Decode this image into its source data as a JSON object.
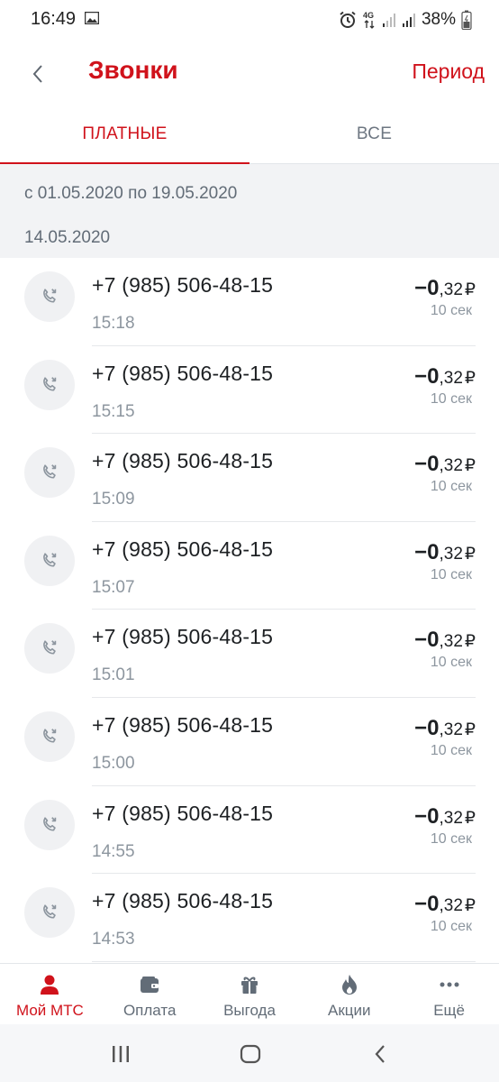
{
  "status_bar": {
    "time": "16:49",
    "battery": "38%",
    "network": "4G",
    "icons": [
      "gallery-icon",
      "alarm-icon",
      "network-4g-icon",
      "signal-icon",
      "signal-icon",
      "battery-icon"
    ]
  },
  "header": {
    "title": "Звонки",
    "period_label": "Период",
    "accent_color": "#d0121b"
  },
  "tabs": [
    {
      "label": "ПЛАТНЫЕ",
      "active": true
    },
    {
      "label": "ВСЕ",
      "active": false
    }
  ],
  "filter": {
    "range": "с 01.05.2020 по 19.05.2020",
    "date_header": "14.05.2020"
  },
  "calls": [
    {
      "number": "+7 (985) 506-48-15",
      "time": "15:18",
      "amount_int": "−0",
      "amount_frac": ",32",
      "currency": "₽",
      "duration": "10 сек"
    },
    {
      "number": "+7 (985) 506-48-15",
      "time": "15:15",
      "amount_int": "−0",
      "amount_frac": ",32",
      "currency": "₽",
      "duration": "10 сек"
    },
    {
      "number": "+7 (985) 506-48-15",
      "time": "15:09",
      "amount_int": "−0",
      "amount_frac": ",32",
      "currency": "₽",
      "duration": "10 сек"
    },
    {
      "number": "+7 (985) 506-48-15",
      "time": "15:07",
      "amount_int": "−0",
      "amount_frac": ",32",
      "currency": "₽",
      "duration": "10 сек"
    },
    {
      "number": "+7 (985) 506-48-15",
      "time": "15:01",
      "amount_int": "−0",
      "amount_frac": ",32",
      "currency": "₽",
      "duration": "10 сек"
    },
    {
      "number": "+7 (985) 506-48-15",
      "time": "15:00",
      "amount_int": "−0",
      "amount_frac": ",32",
      "currency": "₽",
      "duration": "10 сек"
    },
    {
      "number": "+7 (985) 506-48-15",
      "time": "14:55",
      "amount_int": "−0",
      "amount_frac": ",32",
      "currency": "₽",
      "duration": "10 сек"
    },
    {
      "number": "+7 (985) 506-48-15",
      "time": "14:53",
      "amount_int": "−0",
      "amount_frac": ",32",
      "currency": "₽",
      "duration": "10 сек"
    }
  ],
  "bottom_nav": [
    {
      "label": "Мой МТС",
      "icon": "person-icon",
      "active": true
    },
    {
      "label": "Оплата",
      "icon": "wallet-icon",
      "active": false
    },
    {
      "label": "Выгода",
      "icon": "gift-icon",
      "active": false
    },
    {
      "label": "Акции",
      "icon": "flame-icon",
      "active": false
    },
    {
      "label": "Ещё",
      "icon": "more-dots-icon",
      "active": false
    }
  ],
  "system_nav": [
    "recent-apps-icon",
    "home-icon",
    "back-icon"
  ]
}
